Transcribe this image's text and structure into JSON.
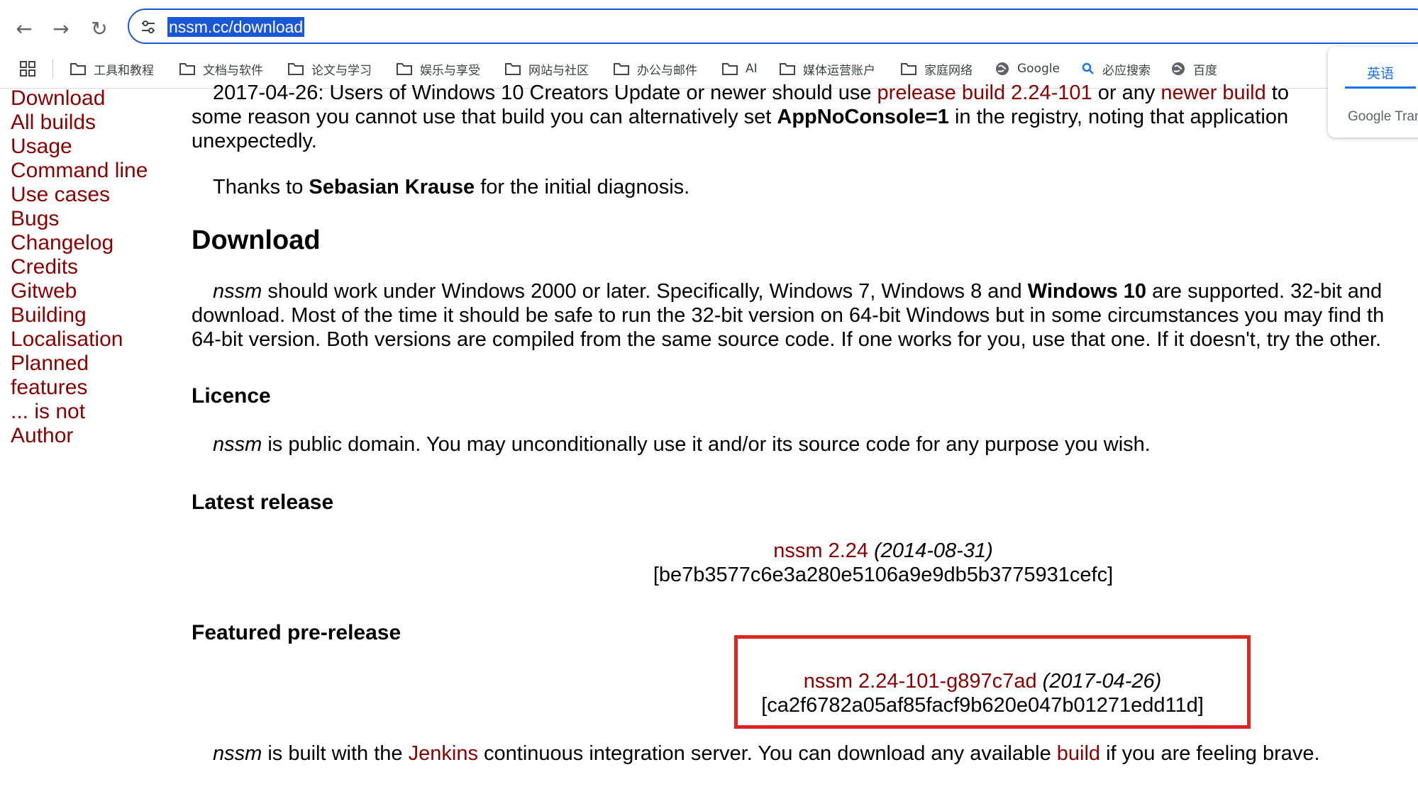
{
  "browser": {
    "url": "nssm.cc/download",
    "bookmarks": [
      "工具和教程",
      "文档与软件",
      "论文与学习",
      "娱乐与享受",
      "网站与社区",
      "办公与邮件",
      "AI",
      "媒体运营账户",
      "家庭网络",
      "Google",
      "必应搜索",
      "百度"
    ]
  },
  "translate": {
    "tab": "英语",
    "brand": "Google Trans"
  },
  "sidebar": {
    "links": [
      "Download",
      "All builds",
      "Usage",
      "Command line",
      "Use cases",
      "Bugs",
      "Changelog",
      "Credits",
      "Gitweb",
      "Building",
      "Localisation",
      "Planned",
      "features",
      "... is not",
      "Author"
    ]
  },
  "page": {
    "intro": {
      "l1_a": "2017-04-26: Users of Windows 10 Creators Update or newer should use ",
      "l1_link1": "prelease build 2.24-101",
      "l1_b": " or any ",
      "l1_link2": "newer build",
      "l1_c": " to",
      "l2_a": "some reason you cannot use that build you can alternatively set ",
      "l2_bold": "AppNoConsole=1",
      "l2_b": " in the registry, noting that application",
      "l3": "unexpectedly."
    },
    "thanks": {
      "a": "Thanks to ",
      "bold": "Sebasian Krause",
      "b": " for the initial diagnosis."
    },
    "download_heading": "Download",
    "download_para": {
      "l1_italic": "nssm",
      "l1_a": " should work under Windows 2000 or later. Specifically, Windows 7, Windows 8 and ",
      "l1_bold": "Windows 10",
      "l1_b": " are supported. 32-bit and",
      "l2": "download. Most of the time it should be safe to run the 32-bit version on 64-bit Windows but in some circumstances you may find th",
      "l3": "64-bit version. Both versions are compiled from the same source code. If one works for you, use that one. If it doesn't, try the other."
    },
    "licence_heading": "Licence",
    "licence_para": {
      "italic": "nssm",
      "text": " is public domain. You may unconditionally use it and/or its source code for any purpose you wish."
    },
    "latest_heading": "Latest release",
    "latest": {
      "link": "nssm 2.24",
      "date": "(2014-08-31)",
      "hash": "[be7b3577c6e3a280e5106a9e9db5b3775931cefc]"
    },
    "prerelease_heading": "Featured pre-release",
    "prerelease": {
      "link": "nssm 2.24-101-g897c7ad",
      "date": "(2017-04-26)",
      "hash": "[ca2f6782a05af85facf9b620e047b01271edd11d]"
    },
    "jenkins_para": {
      "italic": "nssm",
      "a": " is built with the ",
      "link1": "Jenkins",
      "b": " continuous integration server. You can download any available ",
      "link2": "build",
      "c": " if you are feeling brave."
    }
  }
}
